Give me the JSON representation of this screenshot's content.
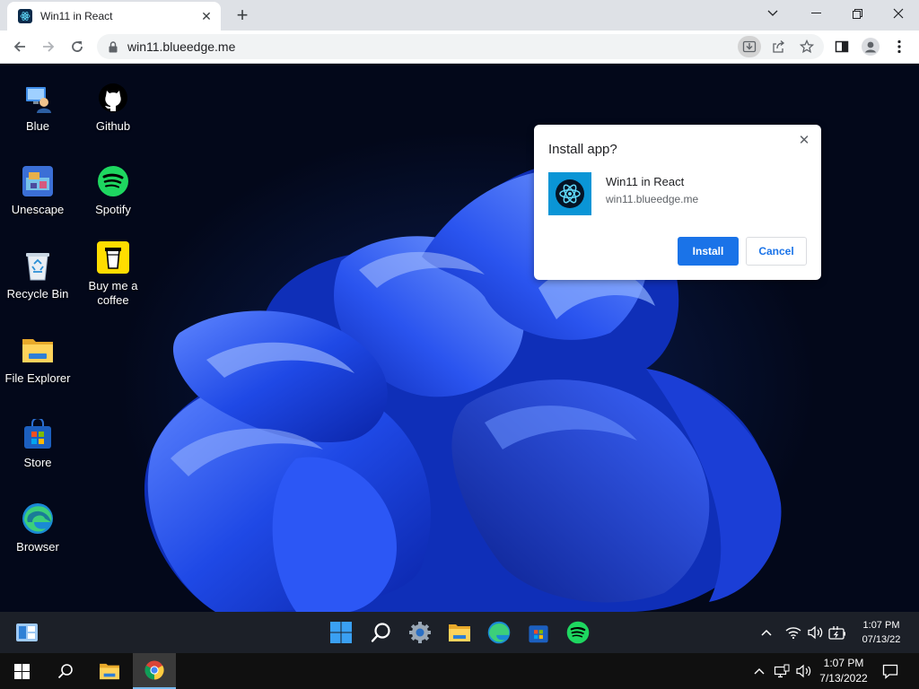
{
  "browser": {
    "tab": {
      "title": "Win11 in React",
      "favicon": "react-icon"
    },
    "url": "win11.blueedge.me"
  },
  "desktop": {
    "icons": [
      {
        "label": "Blue",
        "icon": "user-pc-icon"
      },
      {
        "label": "Github",
        "icon": "github-icon"
      },
      {
        "label": "Unescape",
        "icon": "unescape-game-icon"
      },
      {
        "label": "Spotify",
        "icon": "spotify-icon"
      },
      {
        "label": "Recycle Bin",
        "icon": "recycle-bin-icon"
      },
      {
        "label": "Buy me a coffee",
        "icon": "coffee-cup-icon"
      },
      {
        "label": "File Explorer",
        "icon": "folder-icon"
      },
      {
        "label": "Store",
        "icon": "store-icon"
      },
      {
        "label": "Browser",
        "icon": "edge-icon"
      }
    ]
  },
  "install_popup": {
    "title": "Install app?",
    "app_name": "Win11 in React",
    "app_url": "win11.blueedge.me",
    "install_label": "Install",
    "cancel_label": "Cancel"
  },
  "w11_taskbar": {
    "time": "1:07 PM",
    "date": "07/13/22"
  },
  "w10_taskbar": {
    "time": "1:07 PM",
    "date": "7/13/2022"
  },
  "colors": {
    "accent": "#1a73e8",
    "spotify": "#1ed760",
    "wallpaper": "#1a3cd8"
  }
}
